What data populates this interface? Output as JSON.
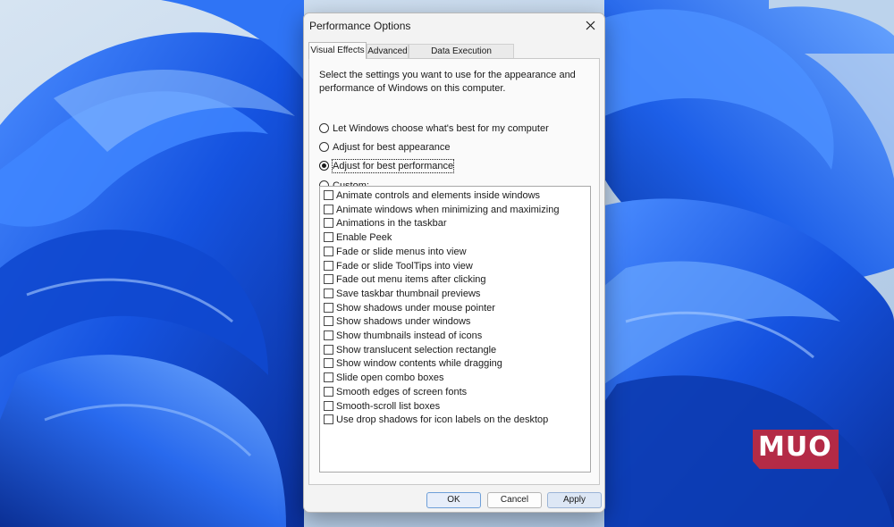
{
  "dialog": {
    "title": "Performance Options",
    "tabs": [
      {
        "label": "Visual Effects",
        "active": true
      },
      {
        "label": "Advanced",
        "active": false
      },
      {
        "label": "Data Execution Prevention",
        "active": false
      }
    ],
    "description": "Select the settings you want to use for the appearance and performance of Windows on this computer.",
    "radio_options": [
      {
        "label": "Let Windows choose what's best for my computer",
        "checked": false
      },
      {
        "label": "Adjust for best appearance",
        "checked": false
      },
      {
        "label": "Adjust for best performance",
        "checked": true
      },
      {
        "label": "Custom:",
        "checked": false
      }
    ],
    "effects": [
      {
        "label": "Animate controls and elements inside windows",
        "checked": false
      },
      {
        "label": "Animate windows when minimizing and maximizing",
        "checked": false
      },
      {
        "label": "Animations in the taskbar",
        "checked": false
      },
      {
        "label": "Enable Peek",
        "checked": false
      },
      {
        "label": "Fade or slide menus into view",
        "checked": false
      },
      {
        "label": "Fade or slide ToolTips into view",
        "checked": false
      },
      {
        "label": "Fade out menu items after clicking",
        "checked": false
      },
      {
        "label": "Save taskbar thumbnail previews",
        "checked": false
      },
      {
        "label": "Show shadows under mouse pointer",
        "checked": false
      },
      {
        "label": "Show shadows under windows",
        "checked": false
      },
      {
        "label": "Show thumbnails instead of icons",
        "checked": false
      },
      {
        "label": "Show translucent selection rectangle",
        "checked": false
      },
      {
        "label": "Show window contents while dragging",
        "checked": false
      },
      {
        "label": "Slide open combo boxes",
        "checked": false
      },
      {
        "label": "Smooth edges of screen fonts",
        "checked": false
      },
      {
        "label": "Smooth-scroll list boxes",
        "checked": false
      },
      {
        "label": "Use drop shadows for icon labels on the desktop",
        "checked": false
      }
    ],
    "buttons": {
      "ok": "OK",
      "cancel": "Cancel",
      "apply": "Apply"
    },
    "close_icon": "close-icon"
  },
  "watermark": {
    "text": "MUO",
    "color": "#d22832"
  },
  "colors": {
    "wallpaper_blue": "#1e5fe0",
    "wallpaper_sky": "#c9dcef",
    "dialog_bg": "#f3f3f3"
  }
}
